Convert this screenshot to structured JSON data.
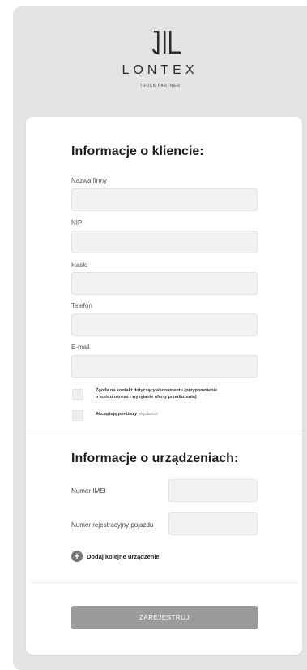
{
  "brand": {
    "name": "LONTEX",
    "tagline": "TRUCK PARTNER",
    "logo_icon": "lontex-logo-icon"
  },
  "client_section": {
    "title": "Informacje o kliencie:",
    "fields": [
      {
        "label": "Nazwa firmy",
        "value": ""
      },
      {
        "label": "NIP",
        "value": ""
      },
      {
        "label": "Hasło",
        "value": ""
      },
      {
        "label": "Telefon",
        "value": ""
      },
      {
        "label": "E-mail",
        "value": ""
      }
    ],
    "consents": [
      {
        "text_line1": "Zgoda na kontakt dotyczący abonamentu (przypomnienie",
        "text_line2": "o końcu okresu i wysyłanie oferty przedłużenia)",
        "checked": false
      },
      {
        "text": "Akceptuję poniższy",
        "link": "regulamin",
        "checked": false
      }
    ]
  },
  "device_section": {
    "title": "Informacje o urządzeniach:",
    "fields": [
      {
        "label": "Numer IMEI",
        "value": ""
      },
      {
        "label": "Numer rejestracyjny pojazdu",
        "value": ""
      }
    ],
    "add_device_label": "Dodaj kolejne urządzenie",
    "add_icon": "plus-circle-icon"
  },
  "submit_label": "ZAREJESTRUJ",
  "colors": {
    "background": "#e4e4e4",
    "card": "#ffffff",
    "field": "#f2f2f2",
    "button": "#9a9a9a"
  }
}
